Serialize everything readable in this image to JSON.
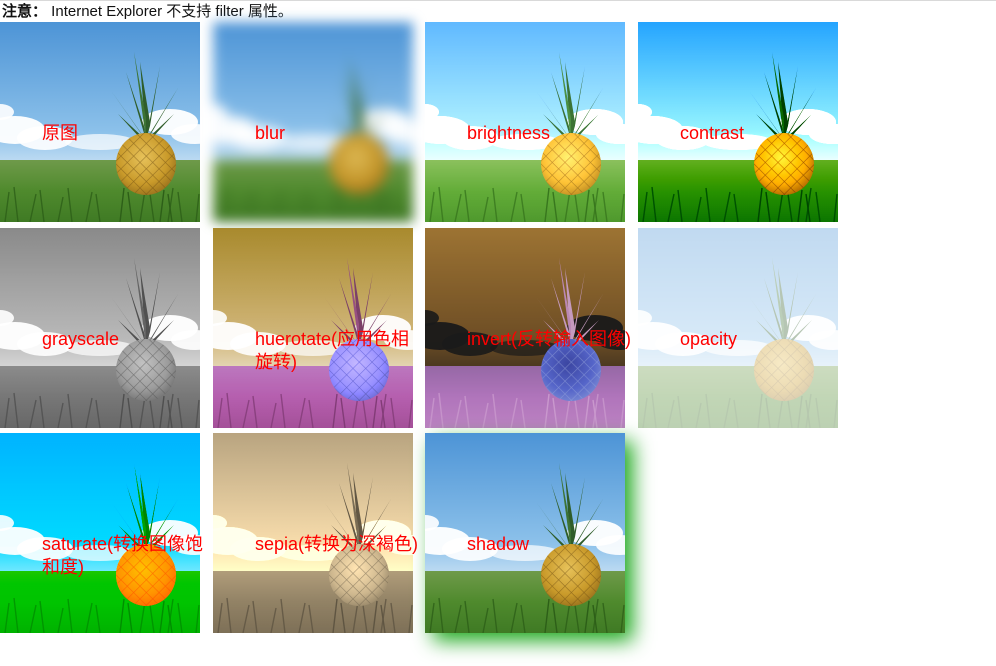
{
  "note": {
    "prefix": "注意：",
    "text": " Internet Explorer 不支持 filter 属性。"
  },
  "tiles": [
    {
      "label": "原图",
      "filter": "none"
    },
    {
      "label": "blur",
      "filter": "blur"
    },
    {
      "label": "brightness",
      "filter": "brightness"
    },
    {
      "label": "contrast",
      "filter": "contrast"
    },
    {
      "label": "grayscale",
      "filter": "grayscale"
    },
    {
      "label": "huerotate(应用色相旋转)",
      "filter": "huerotate"
    },
    {
      "label": "invert(反转输入图像)",
      "filter": "invert"
    },
    {
      "label": "opacity",
      "filter": "opacity"
    },
    {
      "label": "saturate(转换图像饱和度)",
      "filter": "saturate"
    },
    {
      "label": "sepia(转换为深褐色)",
      "filter": "sepia"
    },
    {
      "label": "shadow",
      "filter": "shadow"
    }
  ],
  "colors": {
    "label": "#ff0000",
    "sky_top": "#4d94d6",
    "sky_bottom": "#a9d0ee",
    "grass": "#4f8a2d",
    "pineapple_body": "#c99a2a",
    "pineapple_leaves": "#2f5d2a",
    "shadow": "#1ea81e"
  }
}
